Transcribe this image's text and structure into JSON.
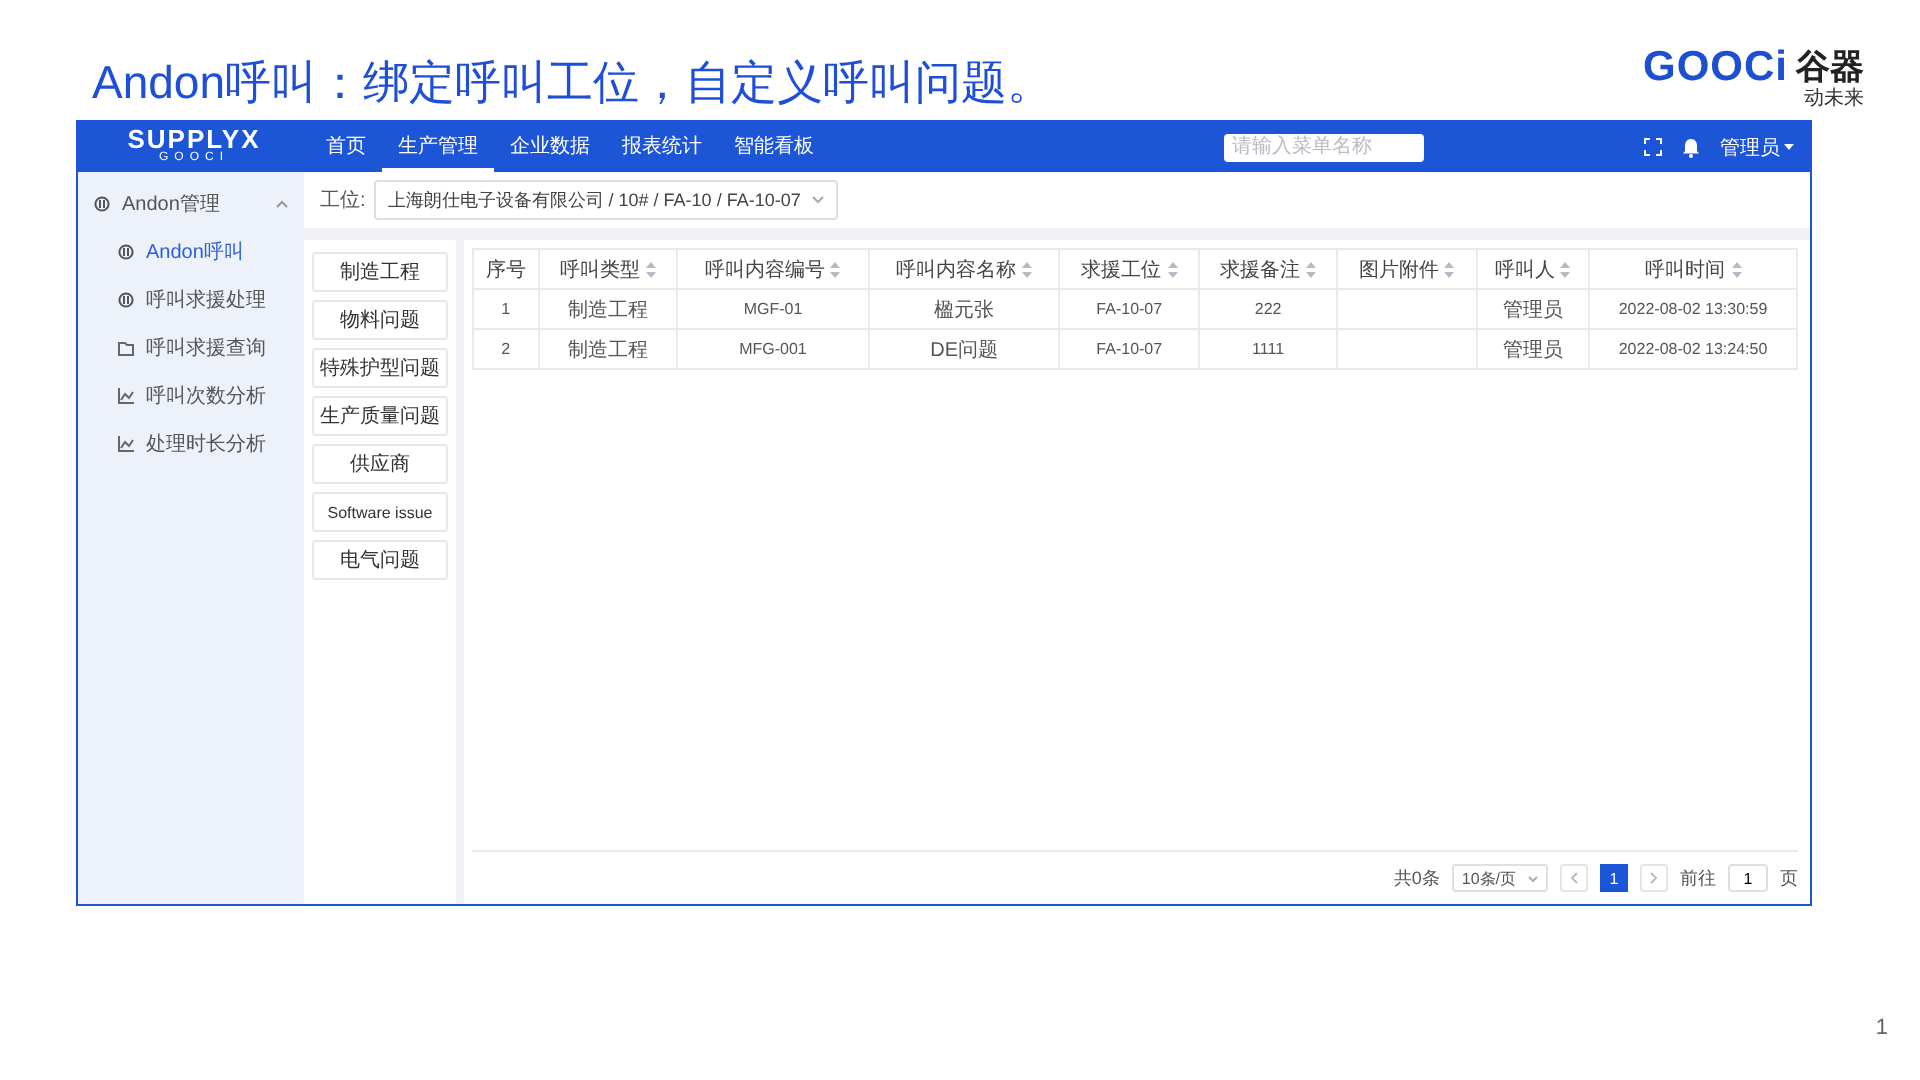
{
  "slide": {
    "title": "Andon呼叫：绑定呼叫工位，自定义呼叫问题。",
    "logo": {
      "brand": "GOOCi",
      "name": "谷器",
      "tagline": "动未来"
    },
    "page_number": "1"
  },
  "app": {
    "brand": {
      "name": "SUPPLYX",
      "sub": "GOOCI"
    },
    "nav": [
      {
        "label": "首页",
        "selected": false
      },
      {
        "label": "生产管理",
        "selected": true
      },
      {
        "label": "企业数据",
        "selected": false
      },
      {
        "label": "报表统计",
        "selected": false
      },
      {
        "label": "智能看板",
        "selected": false
      }
    ],
    "search": {
      "placeholder": "请输入菜单名称"
    },
    "user": "管理员",
    "sidebar": {
      "items": [
        {
          "label": "Andon管理",
          "expanded": true,
          "selected": false,
          "children": [
            {
              "label": "Andon呼叫",
              "selected": true,
              "kind": "call"
            },
            {
              "label": "呼叫求援处理",
              "selected": false,
              "kind": "call"
            },
            {
              "label": "呼叫求援查询",
              "selected": false,
              "kind": "query"
            },
            {
              "label": "呼叫次数分析",
              "selected": false,
              "kind": "analysis"
            },
            {
              "label": "处理时长分析",
              "selected": false,
              "kind": "analysis"
            }
          ]
        }
      ]
    },
    "filter": {
      "label": "工位:",
      "value": "上海朗仕电子设备有限公司 / 10# / FA-10 / FA-10-07"
    },
    "call_types": [
      "制造工程",
      "物料问题",
      "特殊护型问题",
      "生产质量问题",
      "供应商",
      "Software issue",
      "电气问题"
    ],
    "table": {
      "columns": [
        {
          "label": "序号",
          "sortable": false
        },
        {
          "label": "呼叫类型",
          "sortable": true
        },
        {
          "label": "呼叫内容编号",
          "sortable": true
        },
        {
          "label": "呼叫内容名称",
          "sortable": true
        },
        {
          "label": "求援工位",
          "sortable": true
        },
        {
          "label": "求援备注",
          "sortable": true
        },
        {
          "label": "图片附件",
          "sortable": true
        },
        {
          "label": "呼叫人",
          "sortable": true
        },
        {
          "label": "呼叫时间",
          "sortable": true
        }
      ],
      "rows": [
        [
          "1",
          "制造工程",
          "MGF-01",
          "楹元张",
          "FA-10-07",
          "222",
          "",
          "管理员",
          "2022-08-02 13:30:59"
        ],
        [
          "2",
          "制造工程",
          "MFG-001",
          "DE问题",
          "FA-10-07",
          "1111",
          "",
          "管理员",
          "2022-08-02 13:24:50"
        ]
      ]
    },
    "pagination": {
      "total": "共0条",
      "page_size": "10条/页",
      "pages": [
        {
          "label": "1",
          "selected": true
        }
      ],
      "goto_label": "前往",
      "goto_value": "1",
      "goto_unit": "页"
    }
  }
}
